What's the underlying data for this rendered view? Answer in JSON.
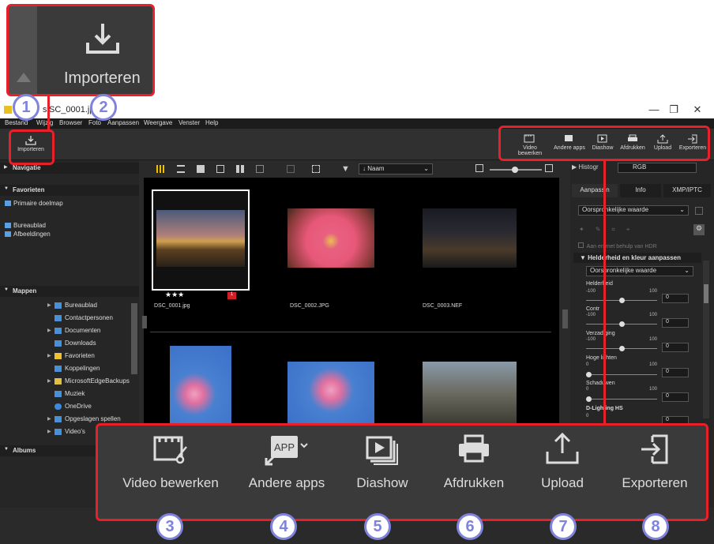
{
  "window": {
    "title": "SC_0001.jpg",
    "title_prefix": "s",
    "controls": [
      "—",
      "❐",
      "✕"
    ]
  },
  "menu": [
    "Bestand",
    "Wijzig",
    "Browser",
    "Foto",
    "Aanpassen",
    "Weergave",
    "Venster",
    "Help"
  ],
  "toolbar": {
    "import_label": "Importeren",
    "buttons": [
      "Video bewerken",
      "Andere apps",
      "Diashow",
      "Afdrukken",
      "Upload",
      "Exporteren"
    ]
  },
  "left_panel": {
    "navigation": "Navigatie",
    "favorites": "Favorieten",
    "fav_items": [
      "Primaire doelmap",
      "Bureaublad",
      "Afbeeldingen"
    ],
    "folders": "Mappen",
    "folder_items": [
      "Bureaublad",
      "Contactpersonen",
      "Documenten",
      "Downloads",
      "Favorieten",
      "Koppelingen",
      "MicrosoftEdgeBackups",
      "Muziek",
      "OneDrive",
      "Opgeslagen spellen",
      "Video's"
    ],
    "albums": "Albums"
  },
  "center": {
    "sort_label": "Naam",
    "files": [
      {
        "name": "DSC_0001.jpg",
        "rating": "★★★",
        "badge": "1"
      },
      {
        "name": "DSC_0002.JPG"
      },
      {
        "name": "DSC_0003.NEF"
      }
    ]
  },
  "right_panel": {
    "histogram_label": "Histogr",
    "histogram_mode": "RGB",
    "tabs": [
      "Aanpassin",
      "Info",
      "XMP/IPTC"
    ],
    "preset": "Oorspronkelijke waarde",
    "hdr_label": "Aan      en met behulp van HDR",
    "section_title": "Helderheid en kleur aanpassen",
    "section_preset": "Oorspronkelijke waarde",
    "sliders": [
      {
        "label": "Helderheid",
        "min": "-100",
        "max": "100",
        "value": "0"
      },
      {
        "label": "Contr",
        "min": "-100",
        "max": "100",
        "value": "0"
      },
      {
        "label": "Verzadiging",
        "min": "-100",
        "max": "100",
        "value": "0"
      },
      {
        "label": "Hoge lichten",
        "min": "0",
        "max": "100",
        "value": "0"
      },
      {
        "label": "Schaduwen",
        "min": "0",
        "max": "100",
        "value": "0"
      },
      {
        "label": "D-Lighting HS",
        "min": "0",
        "max": "",
        "value": "0"
      }
    ]
  },
  "callouts": {
    "big_import_label": "Importeren",
    "big_buttons": [
      "Video bewerken",
      "Andere apps",
      "Diashow",
      "Afdrukken",
      "Upload",
      "Exporteren"
    ],
    "numbers": [
      "1",
      "2",
      "3",
      "4",
      "5",
      "6",
      "7",
      "8"
    ],
    "app_badge": "APP"
  },
  "colors": {
    "callout_red": "#e8202a",
    "callout_circle": "#7f83dc",
    "badge_red": "#d0202a",
    "grid_yellow": "#f0c000"
  }
}
